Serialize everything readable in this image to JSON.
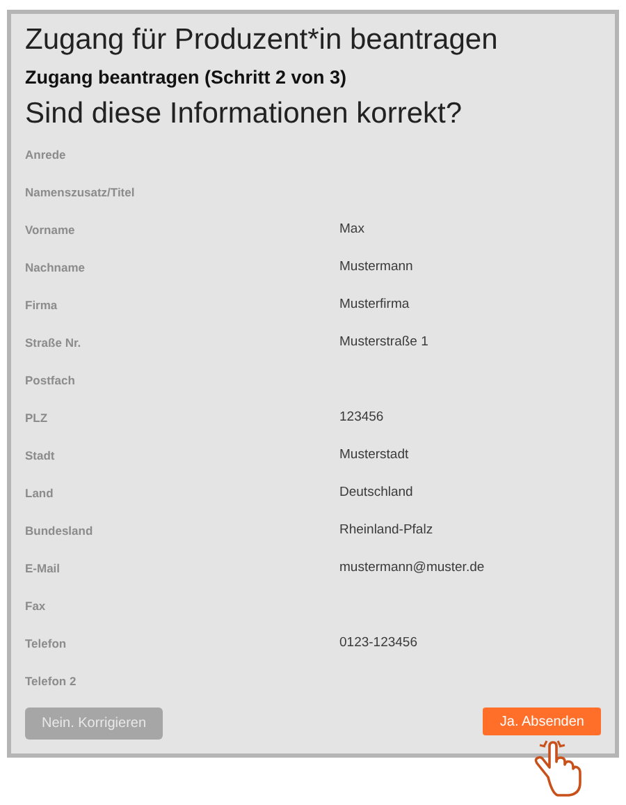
{
  "title": "Zugang für Produzent*in beantragen",
  "step": "Zugang beantragen (Schritt 2 von 3)",
  "question": "Sind diese Informationen korrekt?",
  "fields": [
    {
      "label": "Anrede"
    },
    {
      "label": "Namenszusatz/Titel"
    },
    {
      "label": "Vorname",
      "value": "Max"
    },
    {
      "label": "Nachname",
      "value": "Mustermann"
    },
    {
      "label": "Firma",
      "value": "Musterfirma"
    },
    {
      "label": "Straße Nr.",
      "value": "Musterstraße 1"
    },
    {
      "label": "Postfach"
    },
    {
      "label": "PLZ",
      "value": "123456"
    },
    {
      "label": "Stadt",
      "value": "Musterstadt"
    },
    {
      "label": "Land",
      "value": "Deutschland"
    },
    {
      "label": "Bundesland",
      "value": "Rheinland-Pfalz"
    },
    {
      "label": "E-Mail",
      "value": "mustermann@muster.de"
    },
    {
      "label": "Fax"
    },
    {
      "label": "Telefon",
      "value": "0123-123456"
    },
    {
      "label": "Telefon 2"
    }
  ],
  "buttons": [
    {
      "label": "Nein. Korrigieren",
      "kind": "secondary"
    },
    {
      "label": "Ja. Absenden",
      "kind": "primary"
    }
  ]
}
